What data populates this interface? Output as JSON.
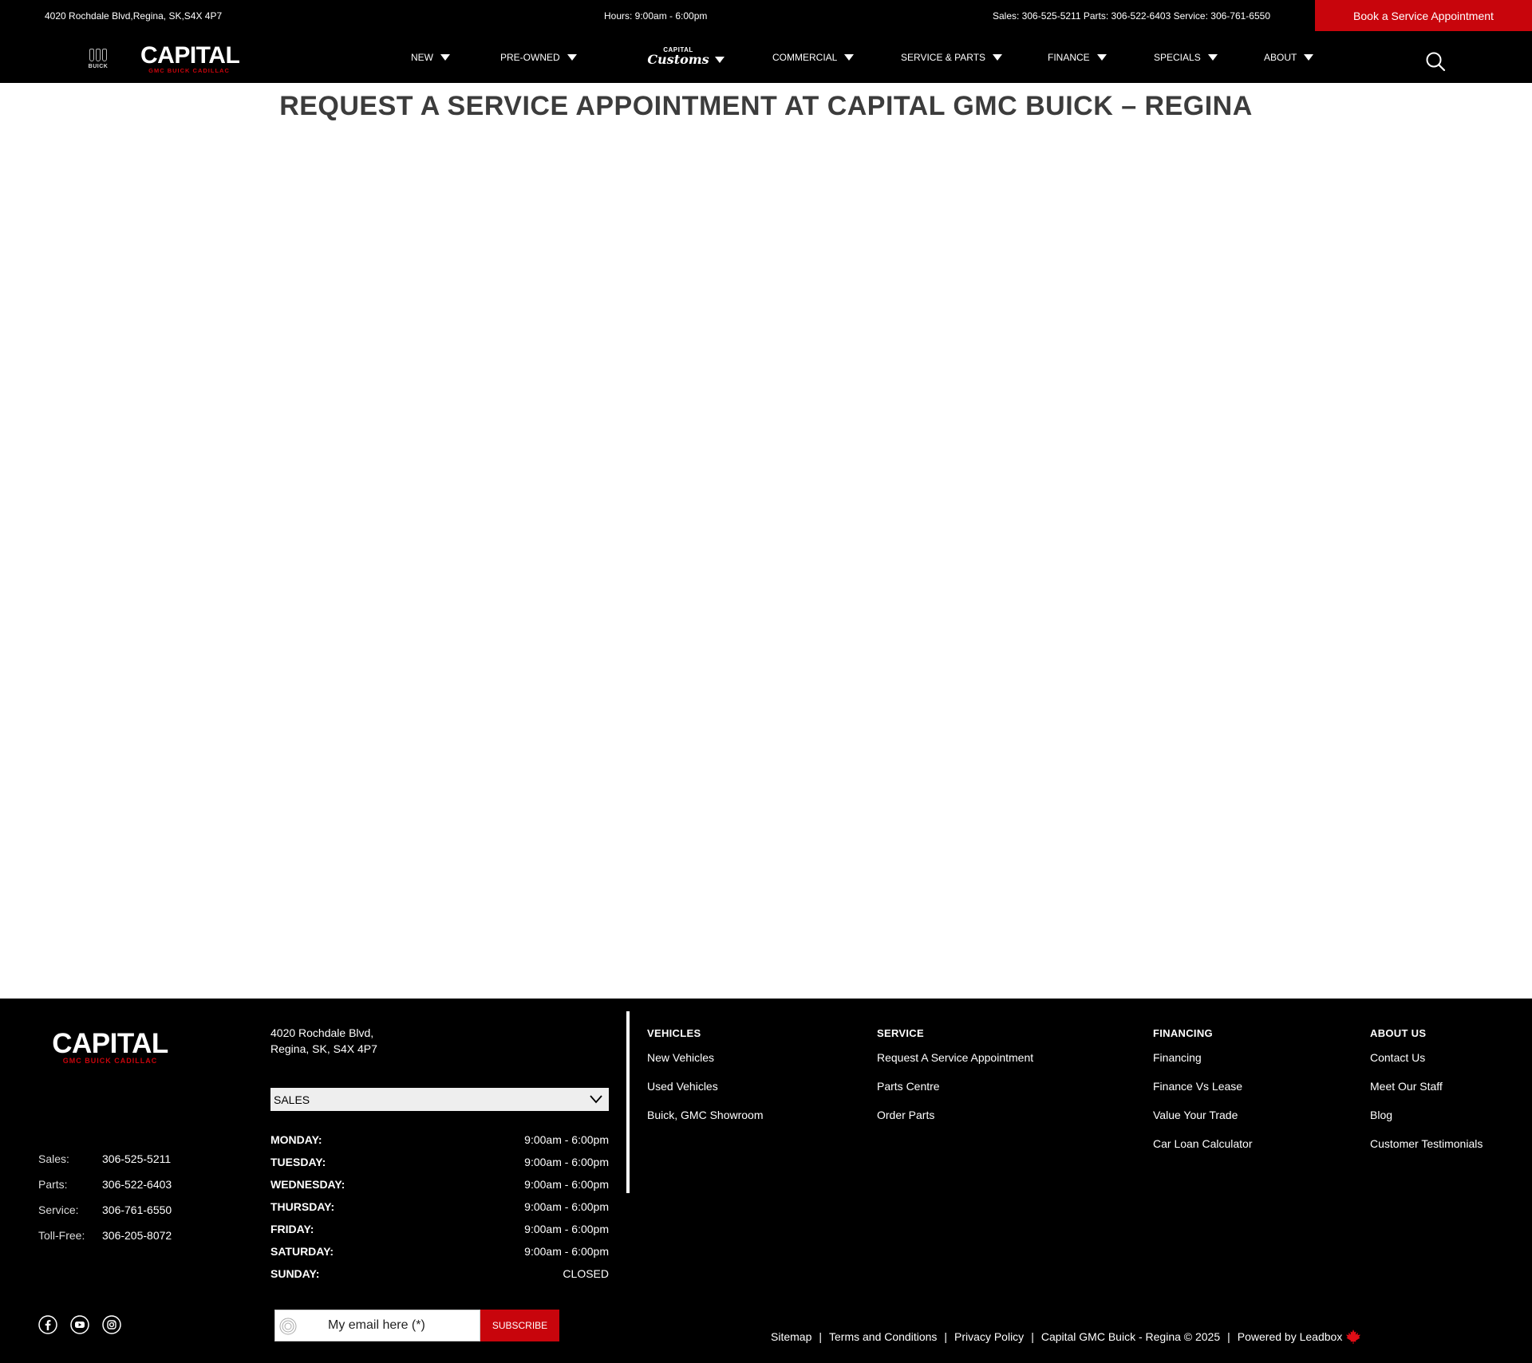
{
  "topbar": {
    "address": "4020 Rochdale Blvd,Regina, SK,S4X 4P7",
    "hours": "Hours: 9:00am - 6:00pm",
    "phones": "Sales: 306-525-5211 Parts: 306-522-6403 Service: 306-761-6550",
    "book_button": "Book a Service Appointment"
  },
  "brand": {
    "emblem_text": "BUICK",
    "logo_main": "CAPITAL",
    "logo_sub": "GMC BUICK CADILLAC"
  },
  "nav": {
    "items": [
      "NEW",
      "PRE-OWNED",
      "COMMERCIAL",
      "SERVICE & PARTS",
      "FINANCE",
      "SPECIALS",
      "ABOUT"
    ],
    "customs_top": "CAPITAL",
    "customs_script": "Customs",
    "search_icon": "search-icon"
  },
  "page": {
    "title": "REQUEST A SERVICE APPOINTMENT AT CAPITAL GMC BUICK – REGINA"
  },
  "footer": {
    "logo_main": "CAPITAL",
    "logo_sub": "GMC BUICK CADILLAC",
    "address_line1": "4020 Rochdale Blvd,",
    "address_line2": "Regina, SK, S4X 4P7",
    "department_select": "SALES",
    "hours": [
      {
        "day": "MONDAY:",
        "time": "9:00am - 6:00pm"
      },
      {
        "day": "TUESDAY:",
        "time": "9:00am - 6:00pm"
      },
      {
        "day": "WEDNESDAY:",
        "time": "9:00am - 6:00pm"
      },
      {
        "day": "THURSDAY:",
        "time": "9:00am - 6:00pm"
      },
      {
        "day": "FRIDAY:",
        "time": "9:00am - 6:00pm"
      },
      {
        "day": "SATURDAY:",
        "time": "9:00am - 6:00pm"
      },
      {
        "day": "SUNDAY:",
        "time": "CLOSED"
      }
    ],
    "contacts": [
      {
        "label": "Sales:",
        "number": "306-525-5211"
      },
      {
        "label": "Parts:",
        "number": "306-522-6403"
      },
      {
        "label": "Service:",
        "number": "306-761-6550"
      },
      {
        "label": "Toll-Free:",
        "number": "306-205-8072"
      }
    ],
    "columns": [
      {
        "heading": "VEHICLES",
        "links": [
          "New Vehicles",
          "Used Vehicles",
          "Buick, GMC Showroom"
        ]
      },
      {
        "heading": "SERVICE",
        "links": [
          "Request A Service Appointment",
          "Parts Centre",
          "Order Parts"
        ]
      },
      {
        "heading": "FINANCING",
        "links": [
          "Financing",
          "Finance Vs Lease",
          "Value Your Trade",
          "Car Loan Calculator"
        ]
      },
      {
        "heading": "ABOUT US",
        "links": [
          "Contact Us",
          "Meet Our Staff",
          "Blog",
          "Customer Testimonials"
        ]
      }
    ],
    "social_icons": [
      "facebook-icon",
      "youtube-icon",
      "instagram-icon"
    ],
    "newsletter": {
      "placeholder": "My email here (*)",
      "button": "SUBSCRIBE"
    },
    "legal": {
      "sitemap": "Sitemap",
      "terms": "Terms and Conditions",
      "privacy": "Privacy Policy",
      "copyright": "Capital GMC Buick - Regina © 2025",
      "powered": "Powered by Leadbox",
      "separator": "|"
    }
  },
  "colors": {
    "accent_red": "#c8050c",
    "bar_black": "#000000",
    "title_gray": "#3c3c3c"
  }
}
